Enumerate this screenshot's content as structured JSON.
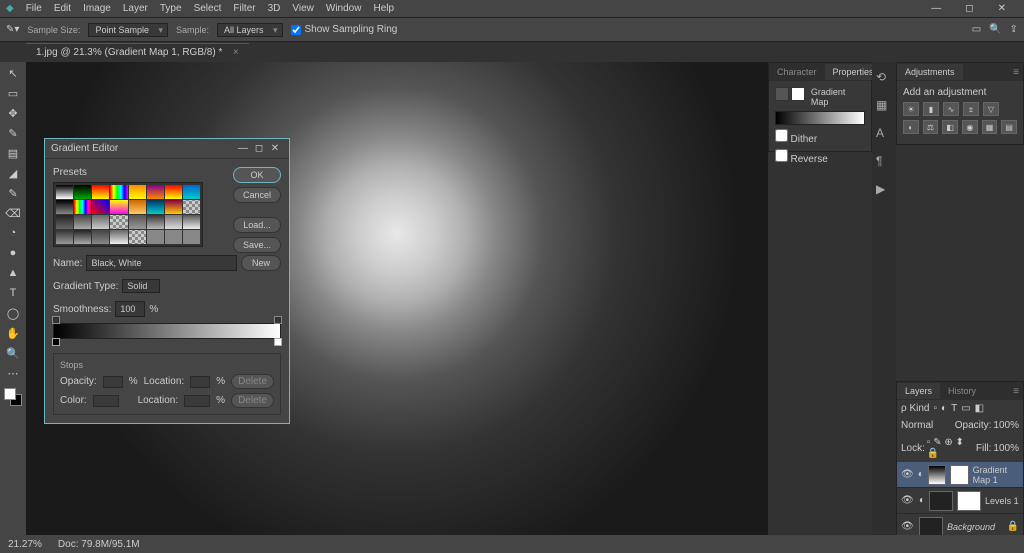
{
  "menu": {
    "items": [
      "File",
      "Edit",
      "Image",
      "Layer",
      "Type",
      "Select",
      "Filter",
      "3D",
      "View",
      "Window",
      "Help"
    ]
  },
  "options": {
    "sampleSizeLabel": "Sample Size:",
    "sampleSizeValue": "Point Sample",
    "sampleLabel": "Sample:",
    "sampleValue": "All Layers",
    "showRingLabel": "Show Sampling Ring"
  },
  "tab": {
    "title": "1.jpg @ 21.3% (Gradient Map 1, RGB/8) *",
    "close": "×"
  },
  "tools": [
    "↖",
    "▭",
    "✥",
    "✎",
    "▤",
    "◢",
    "✎",
    "⌫",
    "◔",
    "●",
    "▲",
    "T",
    "◯",
    "✋",
    "🔍",
    "⋯"
  ],
  "propsPanel": {
    "tab1": "Character",
    "tab2": "Properties",
    "title": "Gradient Map",
    "opt1": "Dither",
    "opt2": "Reverse"
  },
  "adjPanel": {
    "tab": "Adjustments",
    "title": "Add an adjustment"
  },
  "layersPanel": {
    "tab1": "Layers",
    "tab2": "History",
    "kind": "ρ Kind",
    "blend": "Normal",
    "opacityLabel": "Opacity:",
    "opacityVal": "100%",
    "lockLabel": "Lock:",
    "fillLabel": "Fill:",
    "fillVal": "100%",
    "layers": [
      {
        "name": "Gradient Map 1",
        "sel": true
      },
      {
        "name": "Levels 1",
        "sel": false
      },
      {
        "name": "Background",
        "sel": false,
        "locked": true
      }
    ]
  },
  "status": {
    "zoom": "21.27%",
    "doc": "Doc: 79.8M/95.1M"
  },
  "dialog": {
    "title": "Gradient Editor",
    "presetsLabel": "Presets",
    "buttons": {
      "ok": "OK",
      "cancel": "Cancel",
      "load": "Load...",
      "save": "Save..."
    },
    "nameLabel": "Name:",
    "nameValue": "Black, White",
    "newBtn": "New",
    "typeLabel": "Gradient Type:",
    "typeValue": "Solid",
    "smoothLabel": "Smoothness:",
    "smoothValue": "100",
    "smoothUnit": "%",
    "stopsTitle": "Stops",
    "opacityLabel": "Opacity:",
    "opacityUnit": "%",
    "locationLabel": "Location:",
    "locationUnit": "%",
    "colorLabel": "Color:",
    "deleteBtn": "Delete",
    "swatches": [
      "linear-gradient(#000,#fff)",
      "linear-gradient(#000,#0a0)",
      "linear-gradient(#f00,#ff0)",
      "linear-gradient(90deg,#f00,#ff0,#0f0,#0ff,#00f,#f0f)",
      "linear-gradient(#f80,#ff0)",
      "linear-gradient(#808,#f80)",
      "linear-gradient(#f00,#ff0)",
      "linear-gradient(#06c,#0cc)",
      "linear-gradient(#000,#888)",
      "linear-gradient(90deg,#f00,#ff0,#0f0,#0ff,#00f,#f0f,#f00)",
      "linear-gradient(45deg,#f00,#00f)",
      "linear-gradient(#ff0,#f0f)",
      "linear-gradient(#c60,#fc6)",
      "linear-gradient(#036,#0cc)",
      "linear-gradient(#804,#fc0)",
      "repeating-conic-gradient(#888 0 25%,#ccc 0 50%) 0/6px 6px",
      "linear-gradient(#222,#666)",
      "linear-gradient(#444,#aaa)",
      "linear-gradient(#666,#ccc)",
      "repeating-conic-gradient(#888 0 25%,#ccc 0 50%) 0/6px 6px",
      "linear-gradient(#555,#999)",
      "linear-gradient(#333,#bbb)",
      "linear-gradient(#777,#ddd)",
      "linear-gradient(#555,#eee)",
      "linear-gradient(#333,#999)",
      "linear-gradient(#222,#aaa)",
      "linear-gradient(#444,#888)",
      "linear-gradient(#666,#eee)",
      "repeating-conic-gradient(#888 0 25%,#ccc 0 50%) 0/6px 6px",
      "#888",
      "#888",
      "#888"
    ]
  }
}
